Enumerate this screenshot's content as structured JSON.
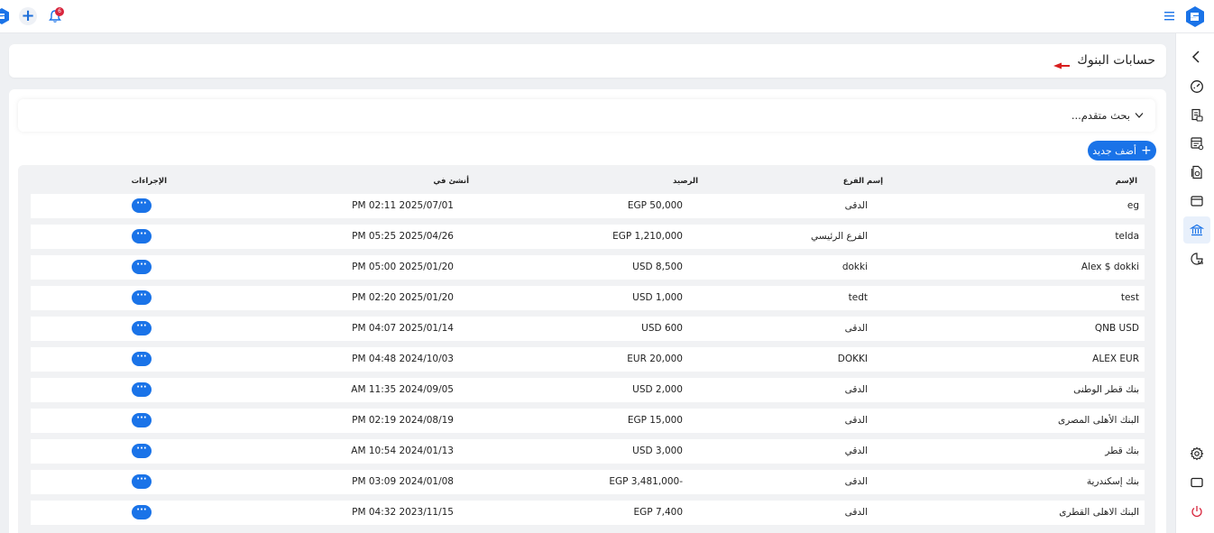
{
  "topbar": {
    "notification_count": "6",
    "add_symbol": "+"
  },
  "page": {
    "title": "حسابات البنوك"
  },
  "search": {
    "advanced_label": "بحث متقدم..."
  },
  "actions": {
    "add_new_label": "أضف جديد",
    "add_icon": "+",
    "row_action_label": "···"
  },
  "table": {
    "headers": {
      "name": "الإسم",
      "branch": "إسم الفرع",
      "balance": "الرصيد",
      "created_at": "أنشئ في",
      "actions": "الإجراءات"
    },
    "rows": [
      {
        "name": "eg",
        "branch": "الدقى",
        "balance": "EGP 50,000",
        "created_at": "PM 02:11 2025/07/01"
      },
      {
        "name": "telda",
        "branch": "الفرع الرئيسي",
        "balance": "EGP 1,210,000",
        "created_at": "PM 05:25 2025/04/26"
      },
      {
        "name": "Alex $ dokki",
        "branch": "dokki",
        "balance": "USD 8,500",
        "created_at": "PM 05:00 2025/01/20"
      },
      {
        "name": "test",
        "branch": "tedt",
        "balance": "USD 1,000",
        "created_at": "PM 02:20 2025/01/20"
      },
      {
        "name": "QNB USD",
        "branch": "الدقى",
        "balance": "USD 600",
        "created_at": "PM 04:07 2025/01/14"
      },
      {
        "name": "ALEX EUR",
        "branch": "DOKKI",
        "balance": "EUR 20,000",
        "created_at": "PM 04:48 2024/10/03"
      },
      {
        "name": "بنك قطر الوطنى",
        "branch": "الدقى",
        "balance": "USD 2,000",
        "created_at": "AM 11:35 2024/09/05"
      },
      {
        "name": "البنك الأهلى المصرى",
        "branch": "الدقى",
        "balance": "EGP 15,000",
        "created_at": "PM 02:19 2024/08/19"
      },
      {
        "name": "بنك قطر",
        "branch": "الدقي",
        "balance": "USD 3,000",
        "created_at": "AM 10:54 2024/01/13"
      },
      {
        "name": "بنك إسكندرية",
        "branch": "الدقى",
        "balance": "EGP 3,481,000-",
        "created_at": "PM 03:09 2024/01/08"
      },
      {
        "name": "البنك الاهلى القطرى",
        "branch": "الدقى",
        "balance": "EGP 7,400",
        "created_at": "PM 04:32 2023/11/15"
      }
    ]
  },
  "sidebar": {
    "items": [
      {
        "icon": "chevron-left-icon"
      },
      {
        "icon": "dashboard-gauge-icon"
      },
      {
        "icon": "invoice-icon"
      },
      {
        "icon": "ledger-icon"
      },
      {
        "icon": "documents-icon"
      },
      {
        "icon": "wallet-icon"
      },
      {
        "icon": "bank-icon"
      },
      {
        "icon": "reports-chart-icon"
      },
      {
        "icon": "settings-gear-icon"
      },
      {
        "icon": "screen-icon"
      },
      {
        "icon": "power-icon"
      }
    ]
  },
  "colors": {
    "primary": "#1a73e8",
    "badge": "#d8263d",
    "arrow": "#d81e1e",
    "power": "#d8263d"
  }
}
